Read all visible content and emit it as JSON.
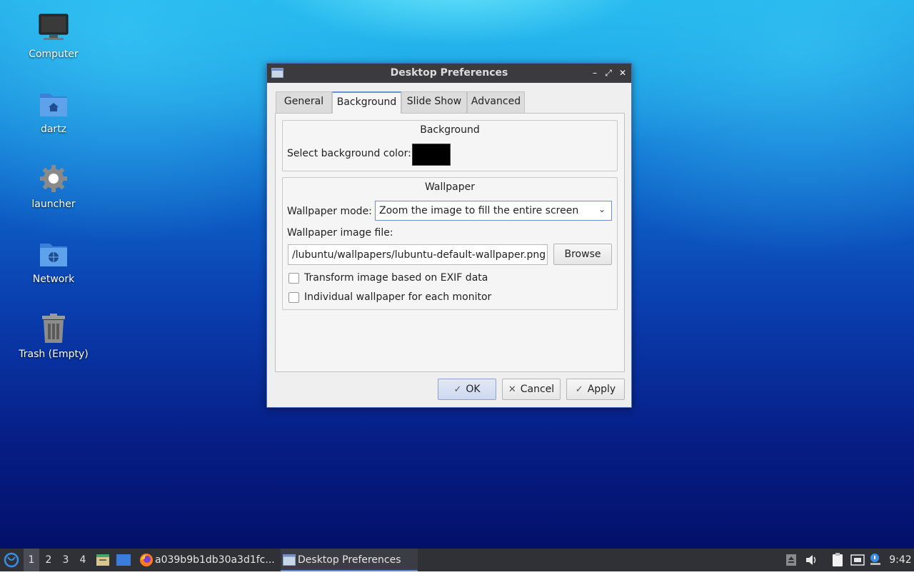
{
  "desktop": {
    "icons": [
      {
        "label": "Computer",
        "icon": "computer-icon"
      },
      {
        "label": "dartz",
        "icon": "home-folder-icon"
      },
      {
        "label": "launcher",
        "icon": "gear-icon"
      },
      {
        "label": "Network",
        "icon": "network-folder-icon"
      },
      {
        "label": "Trash (Empty)",
        "icon": "trash-icon"
      }
    ]
  },
  "window": {
    "title": "Desktop Preferences",
    "controls": {
      "minimize": "–",
      "maximize": "⤢",
      "close": "✕"
    },
    "tabs": [
      "General",
      "Background",
      "Slide Show",
      "Advanced"
    ],
    "active_tab": "Background",
    "background_group": {
      "title": "Background",
      "color_label": "Select background color:",
      "color_value": "#000000"
    },
    "wallpaper_group": {
      "title": "Wallpaper",
      "mode_label": "Wallpaper mode:",
      "mode_value": "Zoom the image to fill the entire screen",
      "file_label": "Wallpaper image file:",
      "file_value": "/lubuntu/wallpapers/lubuntu-default-wallpaper.png",
      "browse_label": "Browse",
      "exif_label": "Transform image based on EXIF data",
      "exif_checked": false,
      "per_monitor_label": "Individual wallpaper for each monitor",
      "per_monitor_checked": false
    },
    "buttons": {
      "ok": "OK",
      "cancel": "Cancel",
      "apply": "Apply"
    }
  },
  "taskbar": {
    "workspaces": [
      "1",
      "2",
      "3",
      "4"
    ],
    "active_workspace": "1",
    "tasks": [
      {
        "label": "a039b9b1db30a3d1fc...",
        "icon": "firefox-icon"
      },
      {
        "label": "Desktop Preferences",
        "icon": "window-icon"
      }
    ],
    "clock": "9:42"
  },
  "colors": {
    "accent": "#6b8fd0",
    "titlebar": "#3b3b3f",
    "taskbar": "#2f3136"
  }
}
